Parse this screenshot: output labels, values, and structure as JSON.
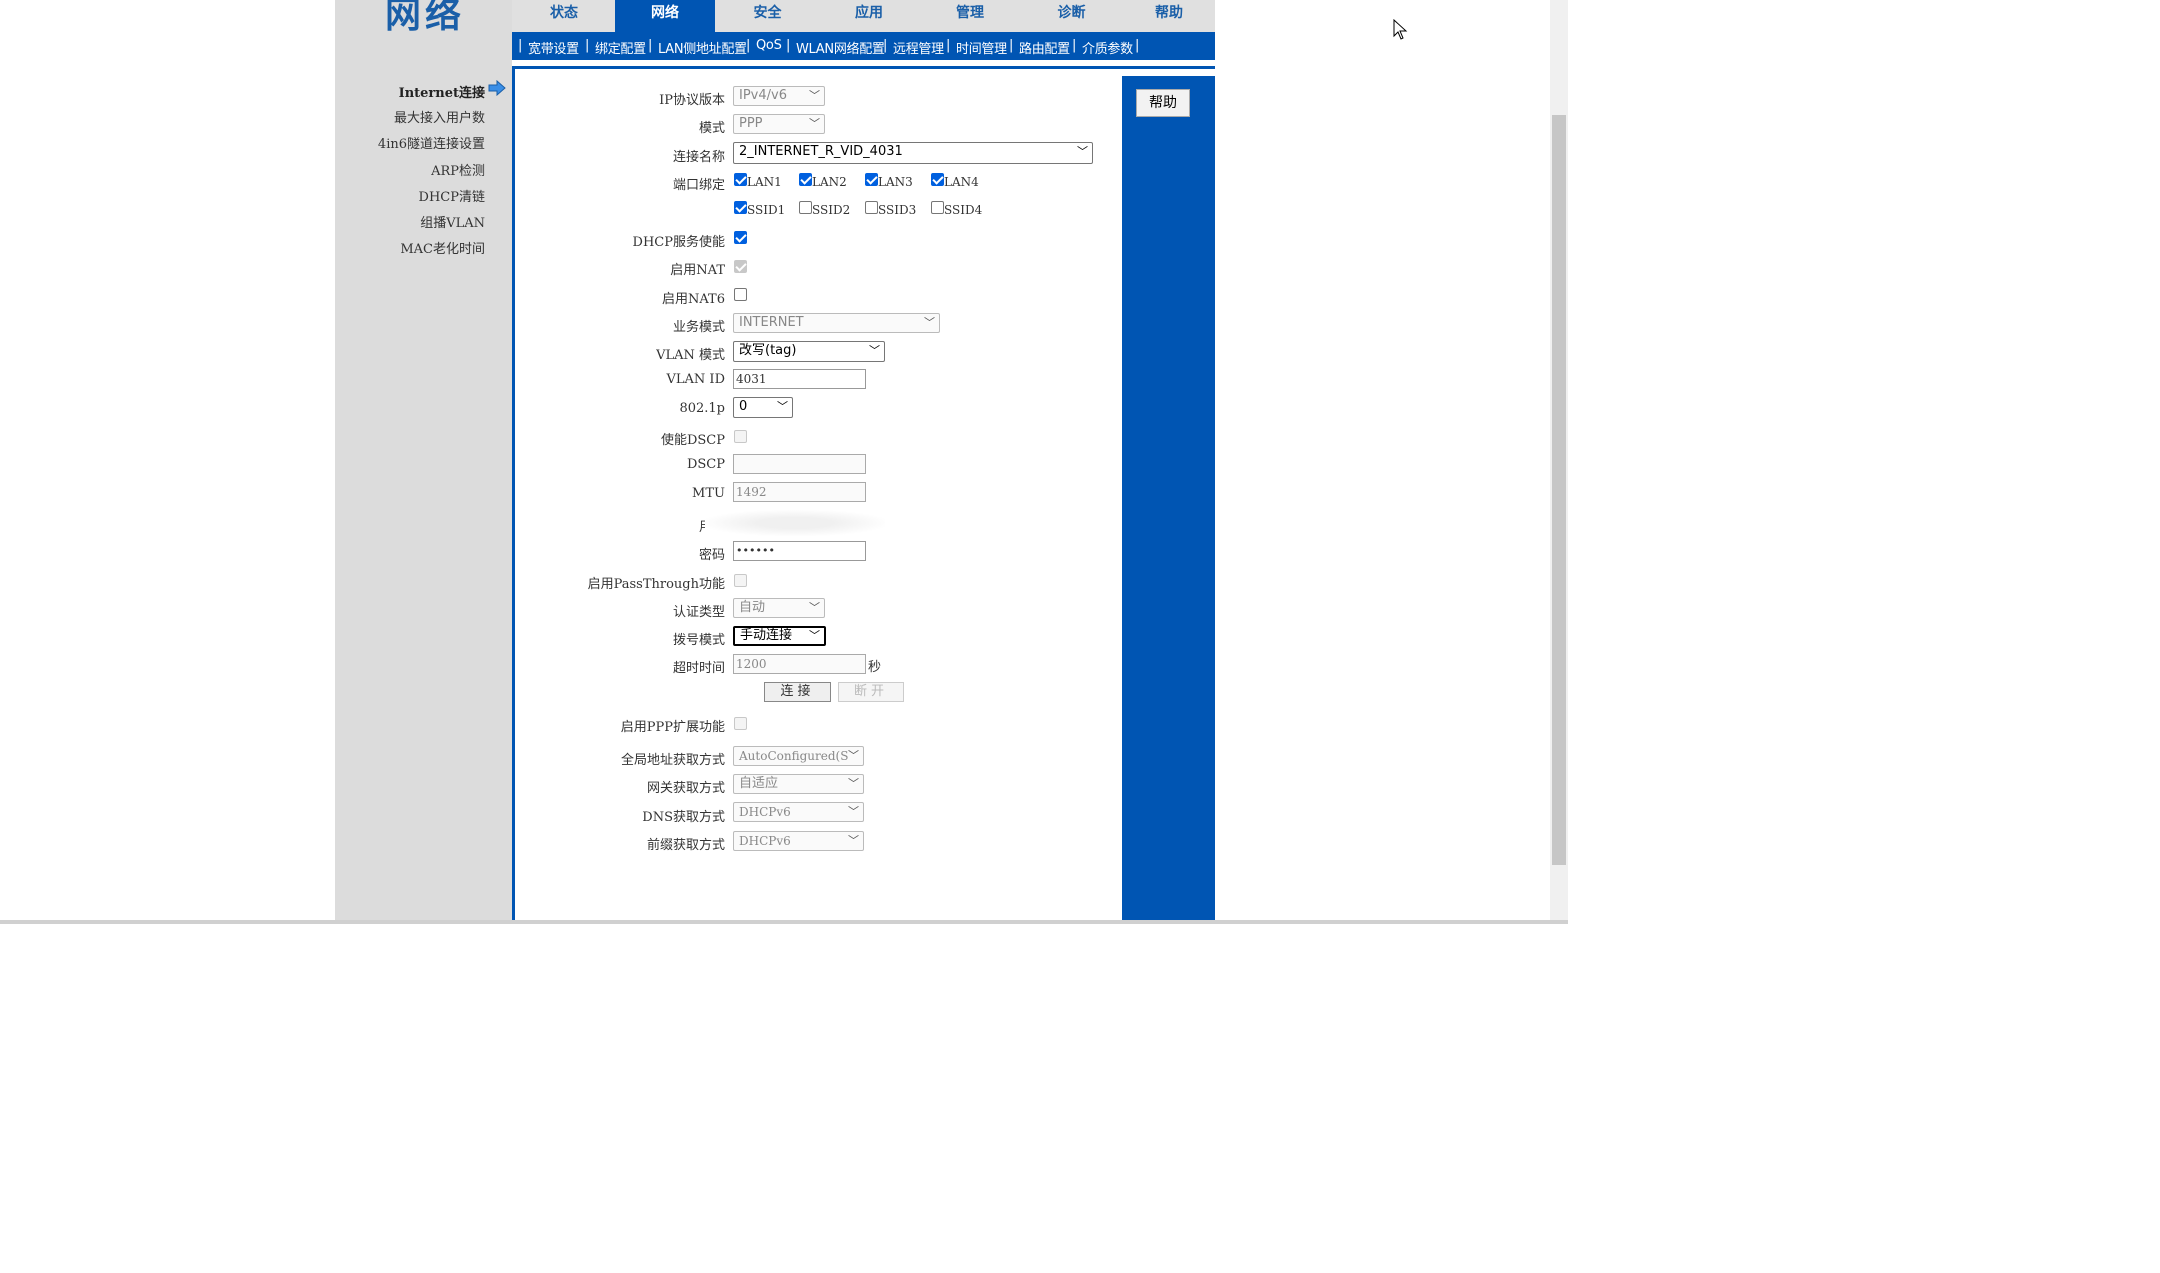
{
  "logo": "网络",
  "tabs": [
    "状态",
    "网络",
    "安全",
    "应用",
    "管理",
    "诊断",
    "帮助"
  ],
  "subnav": [
    "宽带设置",
    "绑定配置",
    "LAN侧地址配置",
    "QoS",
    "WLAN网络配置",
    "远程管理",
    "时间管理",
    "路由配置",
    "介质参数"
  ],
  "left_menu": [
    "Internet连接",
    "最大接入用户数",
    "4in6隧道连接设置",
    "ARP检测",
    "DHCP清链",
    "组播VLAN",
    "MAC老化时间"
  ],
  "help_button": "帮助",
  "form": {
    "ip_version_label": "IP协议版本",
    "ip_version": "IPv4/v6",
    "mode_label": "模式",
    "mode": "PPP",
    "conn_name_label": "连接名称",
    "conn_name": "2_INTERNET_R_VID_4031",
    "port_bind_label": "端口绑定",
    "ports": [
      "LAN1",
      "LAN2",
      "LAN3",
      "LAN4",
      "SSID1",
      "SSID2",
      "SSID3",
      "SSID4"
    ],
    "dhcp_label": "DHCP服务使能",
    "nat_label": "启用NAT",
    "nat6_label": "启用NAT6",
    "service_label": "业务模式",
    "service": "INTERNET",
    "vlan_mode_label": "VLAN 模式",
    "vlan_mode": "改写(tag)",
    "vlan_id_label": "VLAN ID",
    "vlan_id": "4031",
    "p8021_label": "802.1p",
    "p8021": "0",
    "dscp_enable_label": "使能DSCP",
    "dscp_label": "DSCP",
    "dscp": "",
    "mtu_label": "MTU",
    "mtu": "1492",
    "user_label": "用户",
    "password_label": "密码",
    "password": "••••••",
    "passthrough_label": "启用PassThrough功能",
    "auth_label": "认证类型",
    "auth": "自动",
    "dial_label": "拨号模式",
    "dial": "手动连接",
    "timeout_label": "超时时间",
    "timeout": "1200",
    "timeout_unit": "秒",
    "connect_btn": "连接",
    "disconnect_btn": "断开",
    "ppp_ext_label": "启用PPP扩展功能",
    "global_addr_label": "全局地址获取方式",
    "global_addr": "AutoConfigured(S",
    "gateway_label": "网关获取方式",
    "gateway": "自适应",
    "dns_label": "DNS获取方式",
    "dns": "DHCPv6",
    "prefix_label": "前缀获取方式",
    "prefix": "DHCPv6"
  }
}
